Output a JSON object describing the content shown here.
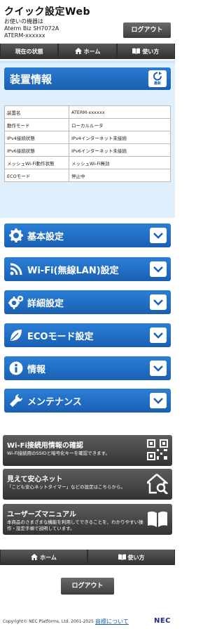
{
  "header": {
    "title": "クイック設定Web",
    "device_lines": [
      "お使いの機器は",
      "Aterm Biz SH7072A",
      "ATERM-xxxxxx"
    ],
    "logout_label": "ログアウト"
  },
  "topnav": {
    "status_label": "現在の状態",
    "home_label": "ホーム",
    "help_label": "使い方"
  },
  "device_info": {
    "title": "装置情報",
    "refresh_label": "最新",
    "rows": [
      {
        "key": "装置名",
        "value": "ATERM-xxxxxx"
      },
      {
        "key": "動作モード",
        "value": "ローカルルータ"
      },
      {
        "key": "IPv4接続状態",
        "value": "IPv4インターネット未接続"
      },
      {
        "key": "IPv6接続状態",
        "value": "IPv6インターネット未接続"
      },
      {
        "key": "メッシュWi-Fi動作状態",
        "value": "メッシュWi-Fi無効"
      },
      {
        "key": "ECOモード",
        "value": "停止中"
      }
    ]
  },
  "menus": [
    {
      "label": "基本設定",
      "icon": "gear-icon"
    },
    {
      "label": "Wi-Fi(無線LAN)設定",
      "icon": "wifi-icon"
    },
    {
      "label": "詳細設定",
      "icon": "gears-icon"
    },
    {
      "label": "ECOモード設定",
      "icon": "leaf-icon"
    },
    {
      "label": "情報",
      "icon": "info-icon"
    },
    {
      "label": "メンテナンス",
      "icon": "wrench-icon"
    }
  ],
  "tiles": [
    {
      "title": "Wi-Fi接続用情報の確認",
      "desc": "Wi-Fi接続用のSSIDと暗号化キーを確認できます。",
      "icon": "qr-code-icon"
    },
    {
      "title": "見えて安心ネット",
      "desc": "「こども安心ネットタイマー」などの設定はこちらから。",
      "icon": "home-search-icon"
    },
    {
      "title": "ユーザーズマニュアル",
      "desc": "本商品のさまざまな機能を利用してできることを、わかりやすい操作・設定手順で説明しています。",
      "icon": "book-icon"
    }
  ],
  "bottomnav": {
    "home_label": "ホーム",
    "help_label": "使い方"
  },
  "logout_label": "ログアウト",
  "footer": {
    "copyright": "Copyright© NEC Platforms, Ltd. 2001-2025",
    "trademark_link": "商標について",
    "logo": "NEC"
  },
  "colors": {
    "accent_blue": "#1a60b3",
    "section_bg": "#dfeffb",
    "dark_button": "#3e3e3e"
  }
}
